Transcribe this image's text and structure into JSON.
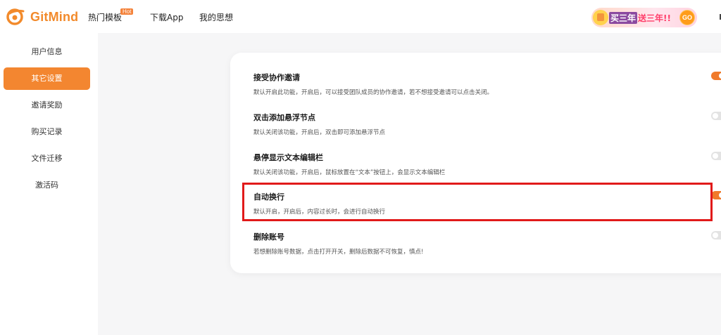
{
  "header": {
    "logo_text": "GitMind",
    "nav": [
      {
        "label": "热门模板"
      },
      {
        "label": "下载App"
      },
      {
        "label": "我的思想"
      }
    ],
    "hot_badge": "Hot",
    "promo": {
      "buy_text": "买三年",
      "gift_text": "送三年!!",
      "go_label": "GO"
    }
  },
  "sidebar": {
    "items": [
      {
        "label": "用户信息",
        "active": false
      },
      {
        "label": "其它设置",
        "active": true
      },
      {
        "label": "邀请奖励",
        "active": false
      },
      {
        "label": "购买记录",
        "active": false
      },
      {
        "label": "文件迁移",
        "active": false
      },
      {
        "label": "激活码",
        "active": false
      }
    ]
  },
  "settings": [
    {
      "title": "接受协作邀请",
      "desc": "默认开启此功能，开启后，可以接受团队成员的协作邀请，若不想接受邀请可以点击关闭。",
      "enabled": true
    },
    {
      "title": "双击添加悬浮节点",
      "desc": "默认关闭该功能，开启后，双击即可添加悬浮节点",
      "enabled": false
    },
    {
      "title": "悬停显示文本编辑栏",
      "desc": "默认关闭该功能，开启后，鼠标放置在“文本”按钮上，会显示文本编辑栏",
      "enabled": false
    },
    {
      "title": "自动换行",
      "desc": "默认开启，开启后，内容过长时，会进行自动换行",
      "enabled": true
    },
    {
      "title": "删除账号",
      "desc": "若想删除账号数据，点击打开开关，删除后数据不可恢复，慎点!",
      "enabled": false
    }
  ],
  "colors": {
    "accent": "#f38630",
    "highlight_border": "#e11a1a"
  }
}
